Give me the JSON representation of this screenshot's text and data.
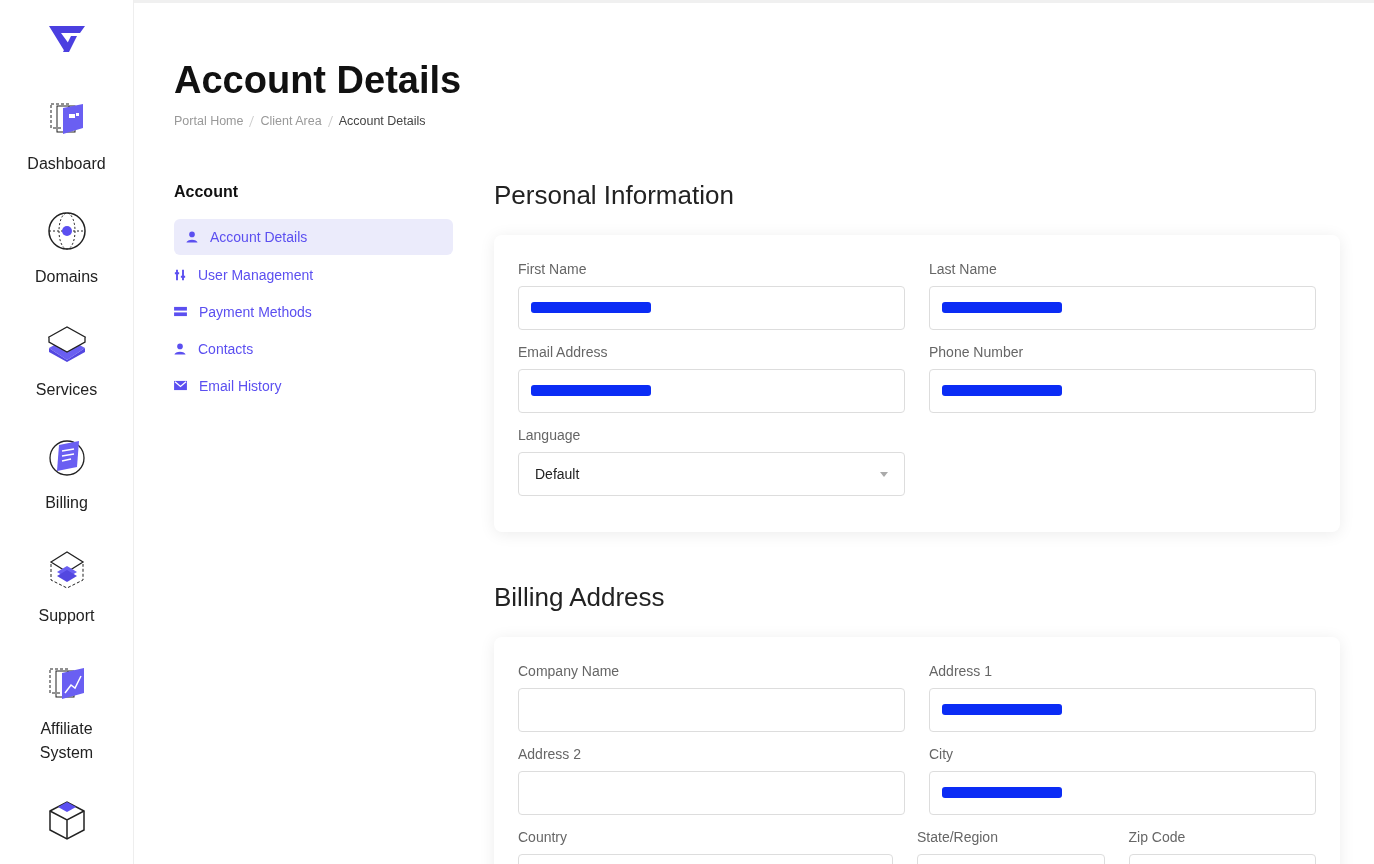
{
  "sidebar": {
    "items": [
      {
        "label": "Dashboard",
        "selected": false
      },
      {
        "label": "Domains",
        "selected": false
      },
      {
        "label": "Services",
        "selected": false
      },
      {
        "label": "Billing",
        "selected": false
      },
      {
        "label": "Support",
        "selected": false
      },
      {
        "label": "Affiliate System",
        "selected": false
      },
      {
        "selected": false
      }
    ]
  },
  "page": {
    "title": "Account Details",
    "breadcrumb": [
      {
        "label": "Portal Home",
        "current": false
      },
      {
        "label": "Client Area",
        "current": false
      },
      {
        "label": "Account Details",
        "current": true
      }
    ]
  },
  "account_nav": {
    "heading": "Account",
    "items": [
      {
        "label": "Account Details",
        "selected": true
      },
      {
        "label": "User Management",
        "selected": false
      },
      {
        "label": "Payment Methods",
        "selected": false
      },
      {
        "label": "Contacts",
        "selected": false
      },
      {
        "label": "Email History",
        "selected": false
      }
    ]
  },
  "sections": [
    {
      "title": "Personal Information",
      "rows": [
        [
          {
            "label": "First Name",
            "kind": "text",
            "redacted": true
          },
          {
            "label": "Last Name",
            "kind": "text",
            "redacted": true
          }
        ],
        [
          {
            "label": "Email Address",
            "kind": "text",
            "redacted": true
          },
          {
            "label": "Phone Number",
            "kind": "text",
            "redacted": true
          }
        ],
        [
          {
            "label": "Language",
            "kind": "select",
            "value": "Default",
            "redacted": false
          }
        ]
      ]
    },
    {
      "title": "Billing Address",
      "rows": [
        [
          {
            "label": "Company Name",
            "kind": "text",
            "redacted": false
          },
          {
            "label": "Address 1",
            "kind": "text",
            "redacted": true
          }
        ],
        [
          {
            "label": "Address 2",
            "kind": "text",
            "redacted": false
          },
          {
            "label": "City",
            "kind": "text",
            "redacted": true
          }
        ],
        [
          {
            "label": "Country",
            "kind": "text"
          },
          {
            "label": "State/Region",
            "kind": "text"
          },
          {
            "label": "Zip Code",
            "kind": "text"
          }
        ]
      ]
    }
  ]
}
